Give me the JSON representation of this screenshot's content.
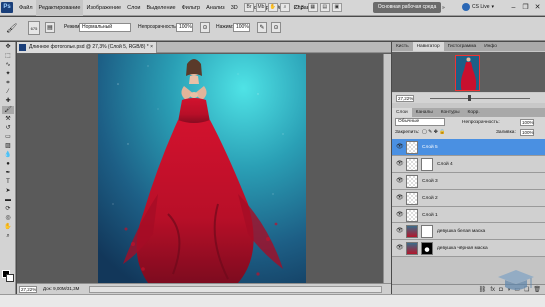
{
  "menubar": {
    "logo": "Ps",
    "items": [
      "Файл",
      "Редактирование",
      "Изображение",
      "Слои",
      "Выделение",
      "Фильтр",
      "Анализ",
      "3D",
      "Просмотр",
      "Окно",
      "Справка"
    ],
    "active_index": 1,
    "zoom": "27,3",
    "workspace_button": "Основная рабочая среда",
    "workspace_dropdown": "»",
    "cs_live": "CS Live",
    "cs_live_arrow": "▾"
  },
  "options": {
    "brush_size": "675",
    "mode_label": "Режим:",
    "mode_value": "Нормальный",
    "opacity_label": "Непрозрачность:",
    "opacity_value": "100%",
    "flow_label": "Нажим:",
    "flow_value": "100%"
  },
  "document": {
    "tab_title": "Длинное фотоголье.psd @ 27,3% (Слой 5, RGB/8) *",
    "tab_close": "×",
    "status_zoom": "27,22%",
    "status_info": "Док: 9,00M/31,3M"
  },
  "panels": {
    "top_tabs": [
      "Кисть",
      "Навигатор",
      "Гистограмма",
      "Инфо"
    ],
    "top_active": 1,
    "nav_zoom": "27,22%",
    "layer_tabs": [
      "Слои",
      "Каналы",
      "Контуры",
      "Корр."
    ],
    "layer_active": 0,
    "blend_mode": "Обычные",
    "opacity_label": "Непрозрачность:",
    "opacity_value": "100%",
    "lock_label": "Закрепить:",
    "fill_label": "Заливка:",
    "fill_value": "100%",
    "layers": [
      {
        "name": "Слой 5",
        "selected": true,
        "thumb": "empty",
        "mask": false
      },
      {
        "name": "Слой 4",
        "selected": false,
        "thumb": "empty",
        "mask": true
      },
      {
        "name": "Слой 3",
        "selected": false,
        "thumb": "empty",
        "mask": false
      },
      {
        "name": "Слой 2",
        "selected": false,
        "thumb": "empty",
        "mask": false
      },
      {
        "name": "Слой 1",
        "selected": false,
        "thumb": "empty",
        "mask": false
      },
      {
        "name": "девушка белая маска",
        "selected": false,
        "thumb": "photo",
        "mask": "white"
      },
      {
        "name": "девушка чёрная маска",
        "selected": false,
        "thumb": "photo",
        "mask": "dark"
      }
    ]
  },
  "colors": {
    "selection": "#4a90e2",
    "dress": "#c8102e",
    "background_teal": "#2a8fa8"
  }
}
